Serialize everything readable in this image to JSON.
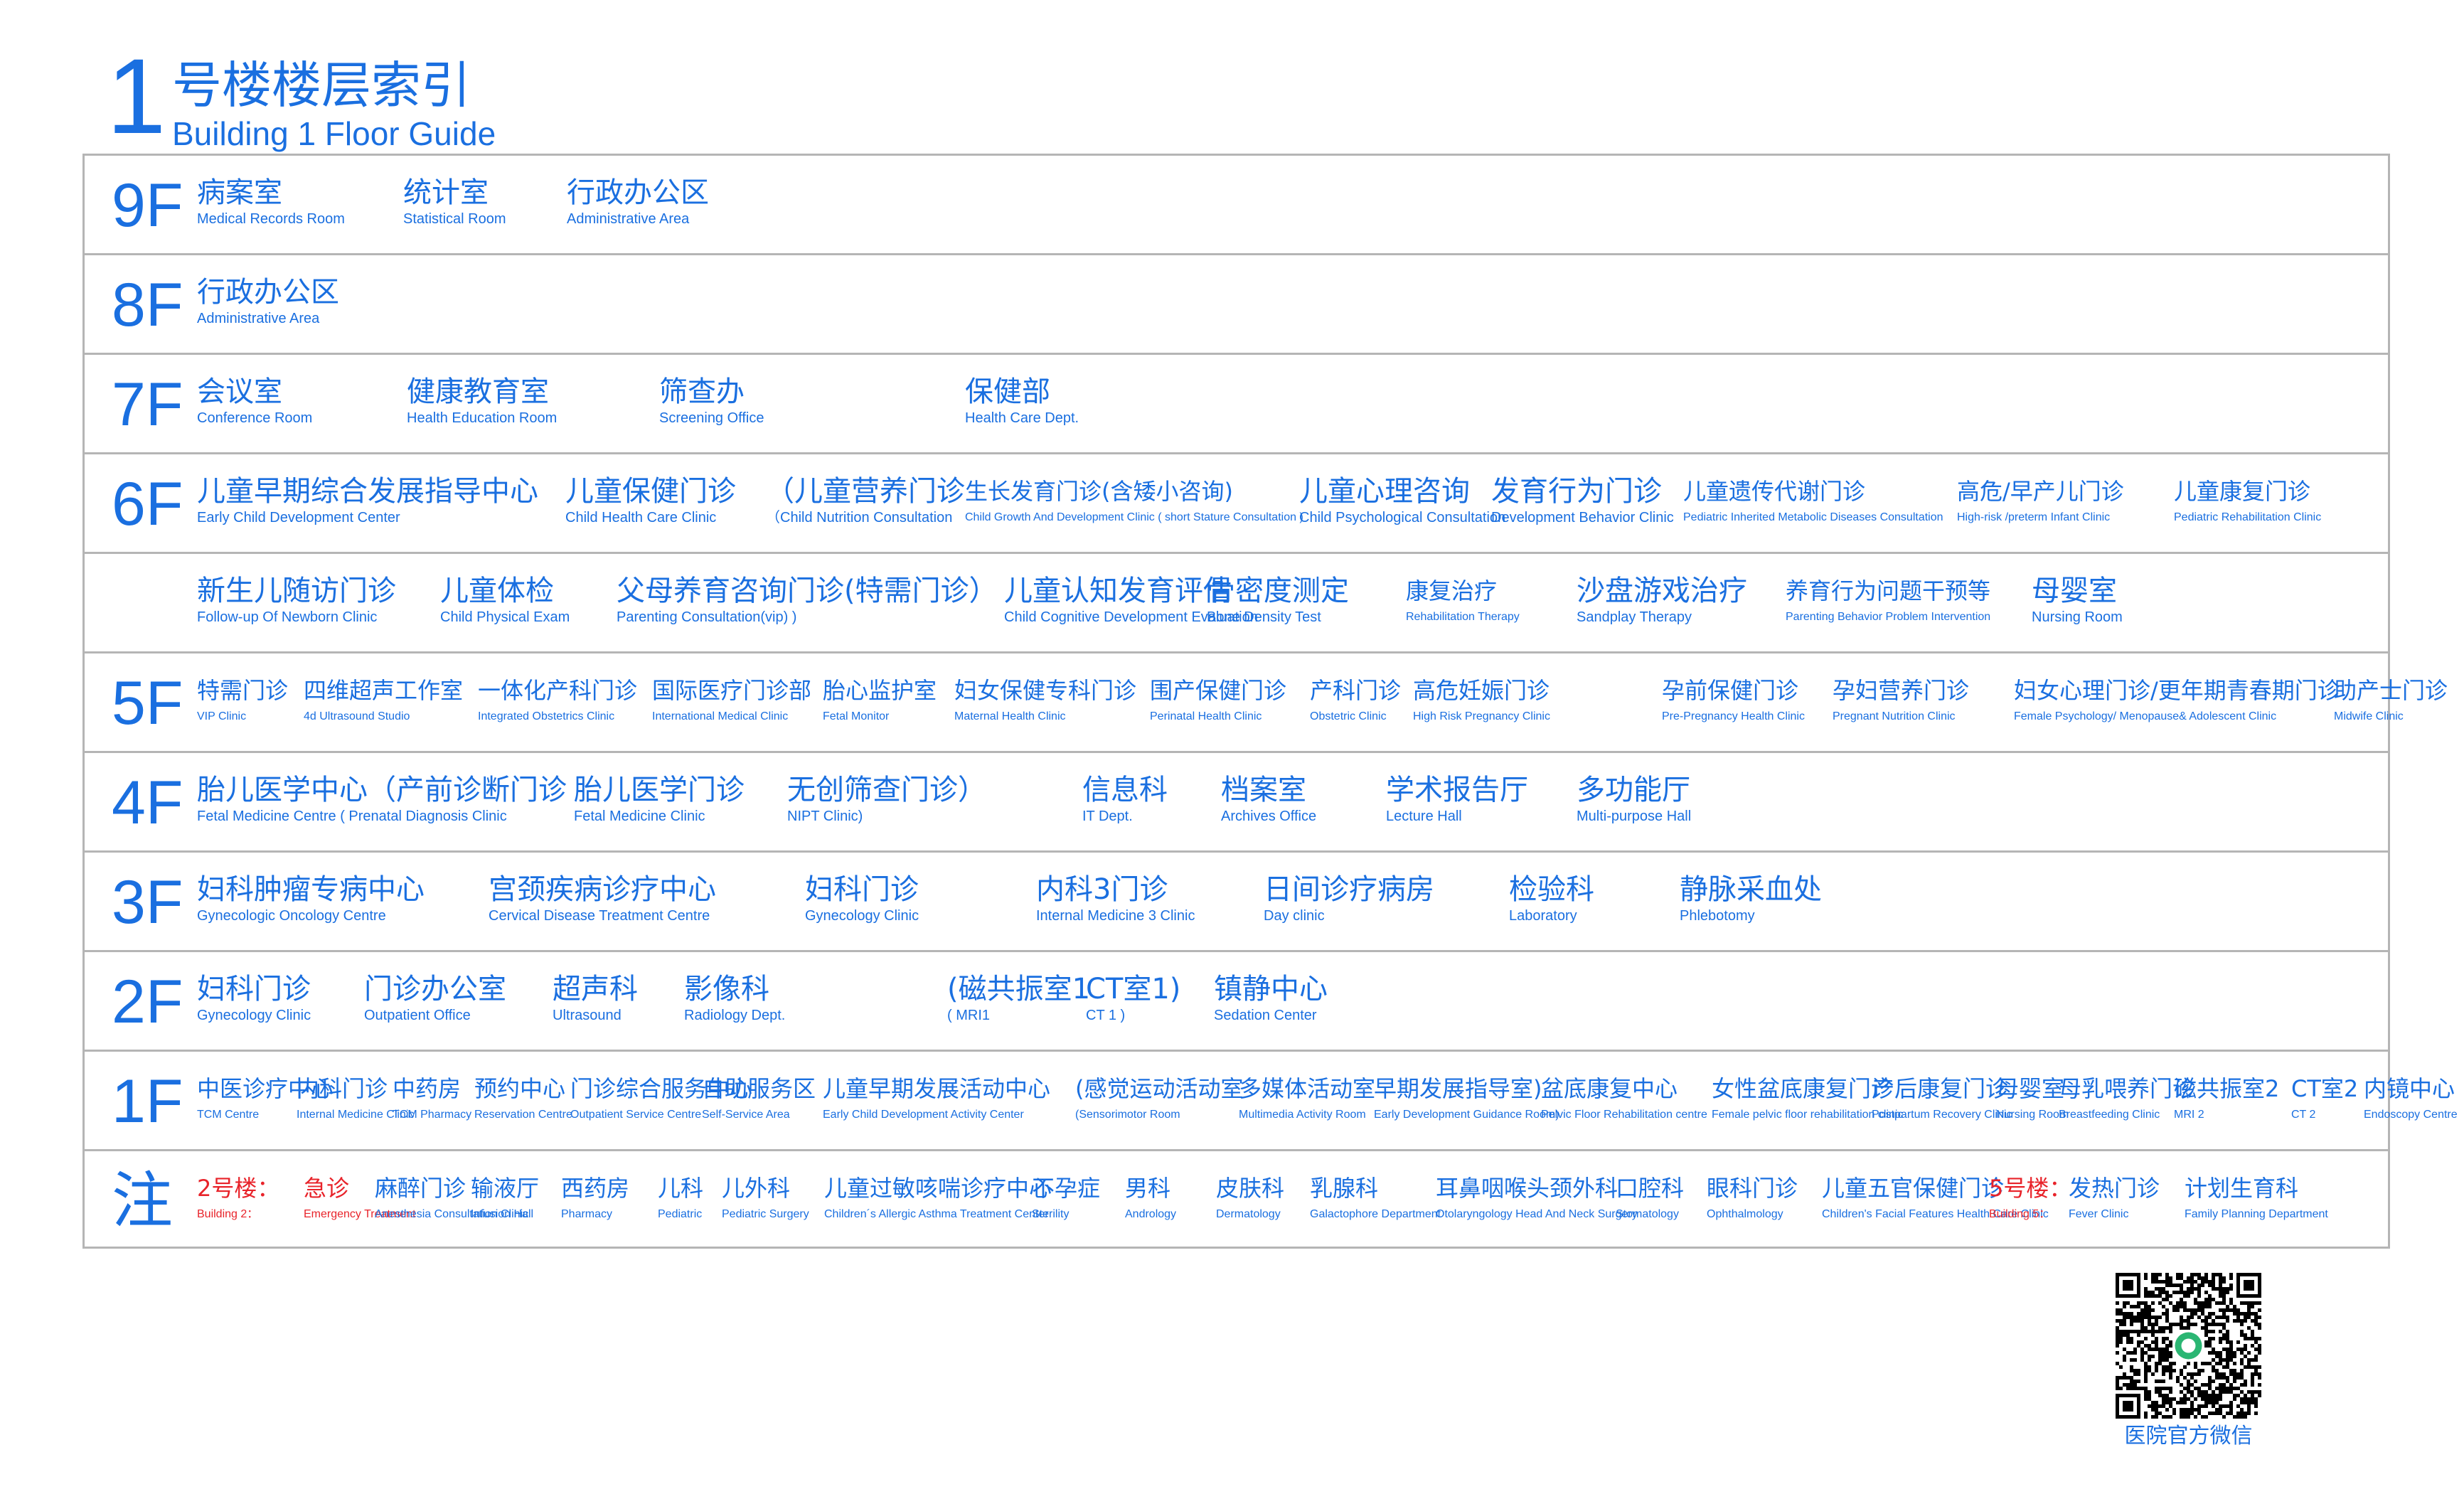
{
  "header": {
    "number": "1",
    "title_cn": "号楼楼层索引",
    "title_en": "Building 1  Floor  Guide"
  },
  "floors": [
    {
      "label": "9F",
      "rooms": [
        {
          "cn": "病案室",
          "en": "Medical Records Room"
        },
        {
          "cn": "统计室",
          "en": "Statistical Room"
        },
        {
          "cn": "行政办公区",
          "en": "Administrative Area"
        }
      ]
    },
    {
      "label": "8F",
      "rooms": [
        {
          "cn": "行政办公区",
          "en": "Administrative Area"
        }
      ]
    },
    {
      "label": "7F",
      "rooms": [
        {
          "cn": "会议室",
          "en": "Conference Room"
        },
        {
          "cn": "健康教育室",
          "en": "Health Education Room"
        },
        {
          "cn": "筛查办",
          "en": "Screening Office"
        },
        {
          "cn": "保健部",
          "en": "Health Care Dept."
        }
      ]
    },
    {
      "label": "6F",
      "rooms": [
        {
          "cn": "儿童早期综合发展指导中心",
          "en": "Early Child Development Center"
        },
        {
          "cn": "儿童保健门诊",
          "en": "Child Health Care Clinic"
        },
        {
          "cn": "（儿童营养门诊",
          "en": "（Child Nutrition Consultation"
        },
        {
          "cn": "生长发育门诊(含矮小咨询)",
          "en": "Child Growth And Development Clinic ( short Stature  Consultation )"
        },
        {
          "cn": "儿童心理咨询",
          "en": "Child Psychological  Consultation"
        },
        {
          "cn": "发育行为门诊",
          "en": "Development Behavior Clinic"
        },
        {
          "cn": "儿童遗传代谢门诊",
          "en": "Pediatric Inherited Metabolic Diseases Consultation"
        },
        {
          "cn": "高危/早产儿门诊",
          "en": "High-risk /preterm Infant Clinic"
        },
        {
          "cn": "儿童康复门诊",
          "en": "Pediatric Rehabilitation Clinic"
        }
      ]
    },
    {
      "label": "",
      "rooms": [
        {
          "cn": "新生儿随访门诊",
          "en": "Follow-up Of Newborn Clinic"
        },
        {
          "cn": "儿童体检",
          "en": "Child Physical Exam"
        },
        {
          "cn": "父母养育咨询门诊(特需门诊）",
          "en": "Parenting  Consultation(vip) )"
        },
        {
          "cn": "儿童认知发育评估",
          "en": "Child Cognitive Development Evaluation"
        },
        {
          "cn": "骨密度测定",
          "en": "Bone Density Test"
        },
        {
          "cn": "康复治疗",
          "en": "Rehabilitation Therapy"
        },
        {
          "cn": "沙盘游戏治疗",
          "en": "Sandplay Therapy"
        },
        {
          "cn": "养育行为问题干预等",
          "en": "Parenting Behavior Problem Intervention"
        },
        {
          "cn": "母婴室",
          "en": "Nursing Room"
        }
      ]
    },
    {
      "label": "5F",
      "rooms": [
        {
          "cn": "特需门诊",
          "en": "VIP Clinic"
        },
        {
          "cn": "四维超声工作室",
          "en": "4d Ultrasound Studio"
        },
        {
          "cn": "一体化产科门诊",
          "en": "Integrated Obstetrics Clinic"
        },
        {
          "cn": "国际医疗门诊部",
          "en": "International Medical Clinic"
        },
        {
          "cn": "胎心监护室",
          "en": "Fetal Monitor"
        },
        {
          "cn": "妇女保健专科门诊",
          "en": "Maternal Health Clinic"
        },
        {
          "cn": "围产保健门诊",
          "en": "Perinatal Health Clinic"
        },
        {
          "cn": "产科门诊",
          "en": "Obstetric Clinic"
        },
        {
          "cn": "高危妊娠门诊",
          "en": "High Risk Pregnancy Clinic"
        },
        {
          "cn": "孕前保健门诊",
          "en": "Pre-Pregnancy Health Clinic"
        },
        {
          "cn": "孕妇营养门诊",
          "en": "Pregnant Nutrition Clinic"
        },
        {
          "cn": "妇女心理门诊/更年期青春期门诊",
          "en": "Female Psychology/ Menopause& Adolescent Clinic"
        },
        {
          "cn": "助产士门诊",
          "en": "Midwife Clinic"
        }
      ]
    },
    {
      "label": "4F",
      "rooms": [
        {
          "cn": "胎儿医学中心（产前诊断门诊",
          "en": "Fetal Medicine Centre   ( Prenatal Diagnosis Clinic"
        },
        {
          "cn": "胎儿医学门诊",
          "en": "Fetal Medicine Clinic"
        },
        {
          "cn": "无创筛查门诊）",
          "en": "NIPT Clinic)"
        },
        {
          "cn": "信息科",
          "en": "IT Dept."
        },
        {
          "cn": "档案室",
          "en": "Archives Office"
        },
        {
          "cn": "学术报告厅",
          "en": "Lecture Hall"
        },
        {
          "cn": "多功能厅",
          "en": "Multi-purpose Hall"
        }
      ]
    },
    {
      "label": "3F",
      "rooms": [
        {
          "cn": "妇科肿瘤专病中心",
          "en": "Gynecologic Oncology Centre"
        },
        {
          "cn": "宫颈疾病诊疗中心",
          "en": "Cervical Disease Treatment Centre"
        },
        {
          "cn": "妇科门诊",
          "en": "Gynecology Clinic"
        },
        {
          "cn": "内科3门诊",
          "en": "Internal Medicine 3 Clinic"
        },
        {
          "cn": "日间诊疗病房",
          "en": "Day clinic"
        },
        {
          "cn": "检验科",
          "en": "Laboratory"
        },
        {
          "cn": "静脉采血处",
          "en": "Phlebotomy"
        }
      ]
    },
    {
      "label": "2F",
      "rooms": [
        {
          "cn": "妇科门诊",
          "en": "Gynecology Clinic"
        },
        {
          "cn": "门诊办公室",
          "en": "Outpatient Office"
        },
        {
          "cn": "超声科",
          "en": "Ultrasound"
        },
        {
          "cn": "影像科",
          "en": "Radiology Dept."
        },
        {
          "cn": "(磁共振室1",
          "en": "(   MRI1"
        },
        {
          "cn": "CT室1)",
          "en": "CT 1          )"
        },
        {
          "cn": "镇静中心",
          "en": "Sedation Center"
        }
      ]
    },
    {
      "label": "1F",
      "rooms": [
        {
          "cn": "中医诊疗中心",
          "en": "TCM Centre"
        },
        {
          "cn": "内科门诊",
          "en": "Internal Medicine Clinic"
        },
        {
          "cn": "中药房",
          "en": "TCM Pharmacy"
        },
        {
          "cn": "预约中心",
          "en": "Reservation Centre"
        },
        {
          "cn": "门诊综合服务中心",
          "en": "Outpatient Service Centre"
        },
        {
          "cn": "自助服务区",
          "en": "Self-Service Area"
        },
        {
          "cn": "儿童早期发展活动中心",
          "en": "Early Child Development Activity Center"
        },
        {
          "cn": "(感觉运动活动室",
          "en": "(Sensorimotor Room"
        },
        {
          "cn": "多媒体活动室",
          "en": "Multimedia Activity Room"
        },
        {
          "cn": "早期发展指导室)",
          "en": "Early Development Guidance Room)"
        },
        {
          "cn": "盆底康复中心",
          "en": "Pelvic Floor Rehabilitation centre"
        },
        {
          "cn": "女性盆底康复门诊",
          "en": "Female pelvic floor rehabilitation clinic"
        },
        {
          "cn": "产后康复门诊",
          "en": "Postpartum Recovery Clinic"
        },
        {
          "cn": "母婴室",
          "en": "Nursing Room"
        },
        {
          "cn": "母乳喂养门诊",
          "en": "Breastfeeding Clinic"
        },
        {
          "cn": "磁共振室2",
          "en": "MRI 2"
        },
        {
          "cn": "CT室2",
          "en": "CT 2"
        },
        {
          "cn": "内镜中心",
          "en": "Endoscopy Centre"
        }
      ]
    },
    {
      "label": "注",
      "rooms": [
        {
          "cn": "2号楼：",
          "en": "Building 2：",
          "red": true
        },
        {
          "cn": "急诊",
          "en": "Emergency Treatment",
          "red": true
        },
        {
          "cn": "麻醉门诊",
          "en": "Anesthesia Consultation Clinic"
        },
        {
          "cn": "输液厅",
          "en": "Infusion Hall"
        },
        {
          "cn": "西药房",
          "en": "Pharmacy"
        },
        {
          "cn": "儿科",
          "en": "Pediatric"
        },
        {
          "cn": "儿外科",
          "en": "Pediatric Surgery"
        },
        {
          "cn": "儿童过敏咳喘诊疗中心",
          "en": "Children´s Allergic Asthma Treatment Center"
        },
        {
          "cn": "不孕症",
          "en": "Sterility"
        },
        {
          "cn": "男科",
          "en": "Andrology"
        },
        {
          "cn": "皮肤科",
          "en": "Dermatology"
        },
        {
          "cn": "乳腺科",
          "en": "Galactophore Department"
        },
        {
          "cn": "耳鼻咽喉头颈外科",
          "en": "Otolaryngology Head And Neck Surgery"
        },
        {
          "cn": "口腔科",
          "en": "Stomatology"
        },
        {
          "cn": "眼科门诊",
          "en": "Ophthalmology"
        },
        {
          "cn": "儿童五官保健门诊",
          "en": "Children's Facial Features Health Care Clinic"
        },
        {
          "cn": "5号楼：",
          "en": "Building 5：",
          "red": true
        },
        {
          "cn": "发热门诊",
          "en": "Fever Clinic"
        },
        {
          "cn": "计划生育科",
          "en": "Family Planning Department"
        }
      ]
    }
  ],
  "qr": {
    "label": "医院官方微信"
  },
  "colors": {
    "blue": "#1a6fe0",
    "red": "#e8232a",
    "border": "#b5b5b5"
  }
}
